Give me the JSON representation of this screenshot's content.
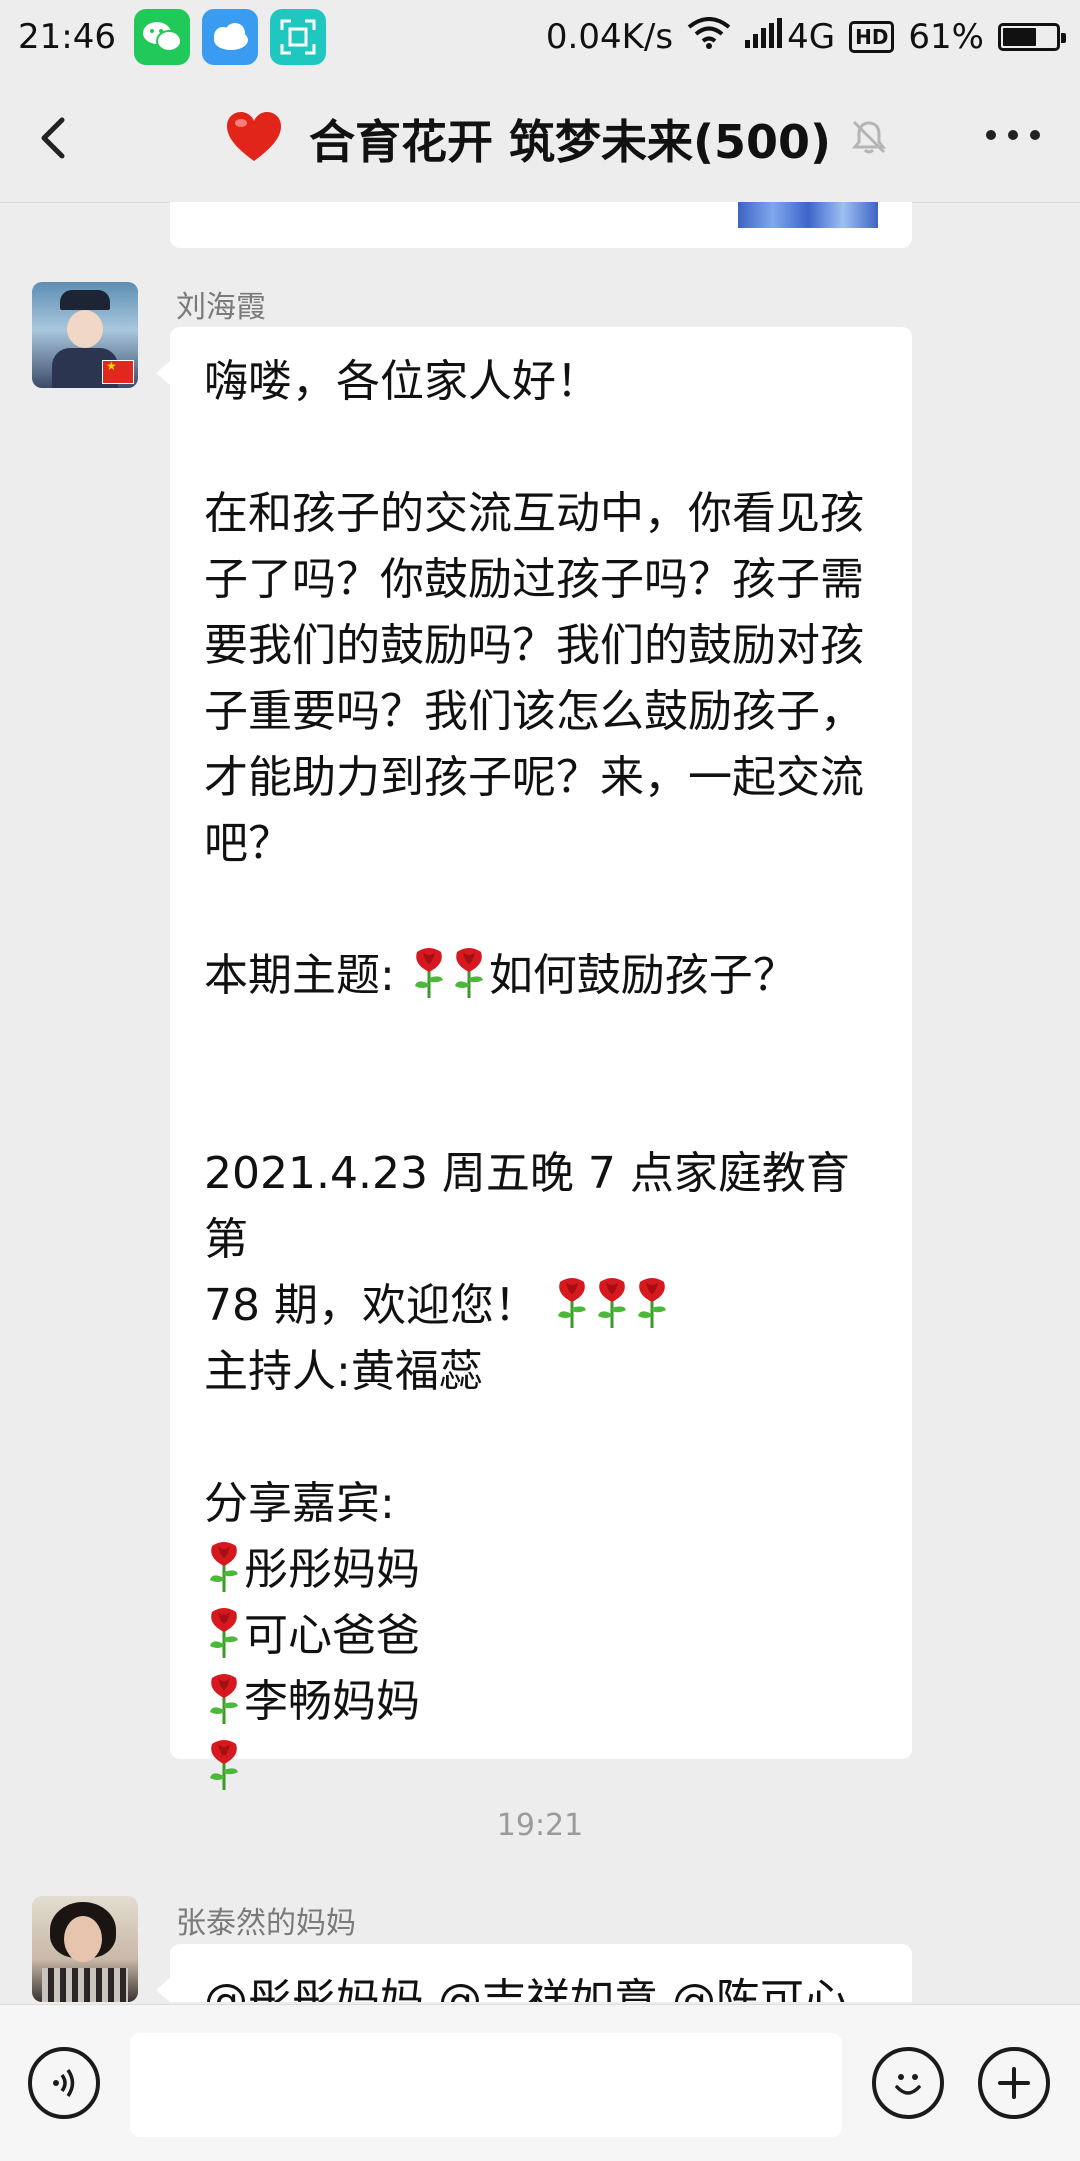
{
  "status_bar": {
    "time": "21:46",
    "network_speed": "0.04K/s",
    "network_type": "4G",
    "hd": "HD",
    "battery": "61%",
    "battery_level": 0.61,
    "apps": [
      "wechat-icon",
      "weather-icon",
      "scan-icon"
    ]
  },
  "header": {
    "title": "合育花开 筑梦未来(500)",
    "emoji": "heart-icon",
    "muted": true
  },
  "messages": [
    {
      "sender": "刘海霞",
      "lines": [
        "嗨喽，各位家人好！",
        "",
        "在和孩子的交流互动中，你看见孩",
        "子了吗？你鼓励过孩子吗？孩子需",
        "要我们的鼓励吗？我们的鼓励对孩",
        "子重要吗？我们该怎么鼓励孩子，",
        "才能助力到孩子呢？来，一起交流",
        "吧？",
        "",
        "本期主题: ",
        "",
        "",
        "2021.4.23 周五晚 7 点家庭教育第",
        "78 期，欢迎您！ ",
        "主持人:黄福蕊",
        "",
        "分享嘉宾:",
        "彤彤妈妈",
        "可心爸爸",
        "李畅妈妈",
        ""
      ],
      "theme_text": "如何鼓励孩子？"
    },
    {
      "sender": "张泰然的妈妈",
      "lines": [
        "@彤彤妈妈 @吉祥如意 @陈可心"
      ]
    }
  ],
  "timestamp": "19:21",
  "input": {
    "placeholder": ""
  }
}
